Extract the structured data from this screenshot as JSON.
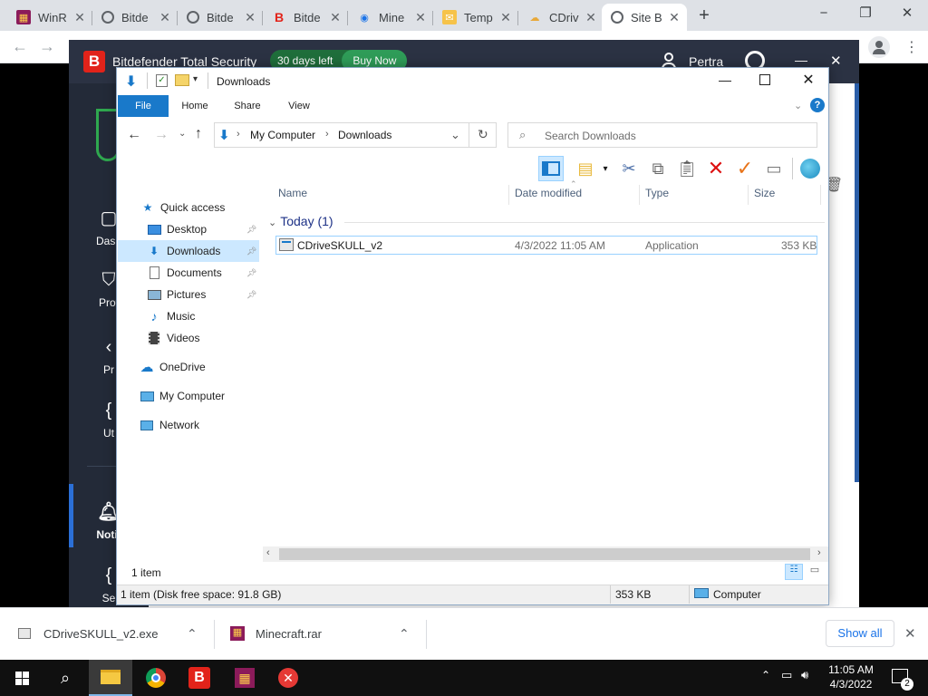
{
  "browser": {
    "tabs": [
      {
        "label": "WinR",
        "favicon": "winrar-icon"
      },
      {
        "label": "Bitde",
        "favicon": "globe-icon"
      },
      {
        "label": "Bitde",
        "favicon": "globe-icon"
      },
      {
        "label": "Bitde",
        "favicon": "bitdefender-icon"
      },
      {
        "label": "Mine",
        "favicon": "mine-icon"
      },
      {
        "label": "Temp",
        "favicon": "mail-icon"
      },
      {
        "label": "CDriv",
        "favicon": "cloud-icon"
      },
      {
        "label": "Site B",
        "favicon": "globe-icon"
      }
    ],
    "window_controls": [
      "−",
      "❐",
      "✕"
    ]
  },
  "bitdefender": {
    "logo": "B",
    "title": "Bitdefender Total Security",
    "trial": "30 days left",
    "buy": "Buy Now",
    "user": "Pertra",
    "nav": [
      "Dash",
      "Prot",
      "Pr",
      "Ut",
      "Notif",
      "Se"
    ]
  },
  "explorer": {
    "title": "Downloads",
    "ribbon_tabs": [
      "File",
      "Home",
      "Share",
      "View"
    ],
    "breadcrumb": [
      "My Computer",
      "Downloads"
    ],
    "search_placeholder": "Search Downloads",
    "nav": {
      "quick_access": "Quick access",
      "desktop": "Desktop",
      "downloads": "Downloads",
      "documents": "Documents",
      "pictures": "Pictures",
      "music": "Music",
      "videos": "Videos",
      "onedrive": "OneDrive",
      "my_computer": "My Computer",
      "network": "Network"
    },
    "columns": [
      "Name",
      "Date modified",
      "Type",
      "Size"
    ],
    "group": "Today (1)",
    "files": [
      {
        "name": "CDriveSKULL_v2",
        "date": "4/3/2022 11:05 AM",
        "type": "Application",
        "size": "353 KB"
      }
    ],
    "item_count": "1 item",
    "status_details": "1 item (Disk free space: 91.8 GB)",
    "status_size": "353 KB",
    "status_location": "Computer"
  },
  "downloads_shelf": {
    "items": [
      "CDriveSKULL_v2.exe",
      "Minecraft.rar"
    ],
    "show_all": "Show all"
  },
  "taskbar": {
    "time": "11:05 AM",
    "date": "4/3/2022",
    "notification_count": "2"
  }
}
